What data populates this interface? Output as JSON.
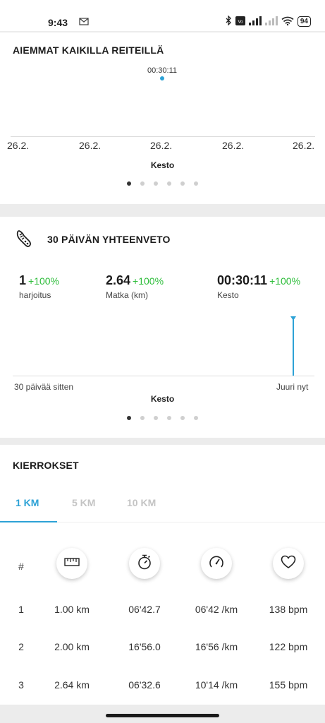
{
  "status_bar": {
    "time": "9:43",
    "mail_icon": "gmail-icon",
    "battery": "94"
  },
  "previous_routes": {
    "title": "AIEMMAT KAIKILLA REITEILLÄ",
    "point_label": "00:30:11",
    "x_labels": [
      "26.2.",
      "26.2.",
      "26.2.",
      "26.2.",
      "26.2."
    ],
    "axis_title": "Kesto",
    "page_count": 6,
    "active_page": 0
  },
  "summary": {
    "icon": "running-shoe-icon",
    "title": "30 PÄIVÄN YHTEENVETO",
    "stats": [
      {
        "value": "1",
        "change": "+100%",
        "label": "harjoitus"
      },
      {
        "value": "2.64",
        "change": "+100%",
        "label": "Matka (km)"
      },
      {
        "value": "00:30:11",
        "change": "+100%",
        "label": "Kesto"
      }
    ],
    "x_start": "30 päivää sitten",
    "x_end": "Juuri nyt",
    "axis_title": "Kesto",
    "page_count": 6,
    "active_page": 0
  },
  "laps": {
    "title": "KIERROKSET",
    "tabs": [
      "1 KM",
      "5 KM",
      "10 KM"
    ],
    "active_tab": 0,
    "hash_header": "#",
    "column_icons": [
      "ruler-icon",
      "stopwatch-icon",
      "speedometer-icon",
      "heart-icon"
    ],
    "rows": [
      [
        "1",
        "1.00 km",
        "06'42.7",
        "06'42 /km",
        "138 bpm"
      ],
      [
        "2",
        "2.00 km",
        "16'56.0",
        "16'56 /km",
        "122 bpm"
      ],
      [
        "3",
        "2.64 km",
        "06'32.6",
        "10'14 /km",
        "155 bpm"
      ]
    ]
  },
  "colors": {
    "accent": "#2da2d6",
    "positive": "#2dbd3a"
  }
}
